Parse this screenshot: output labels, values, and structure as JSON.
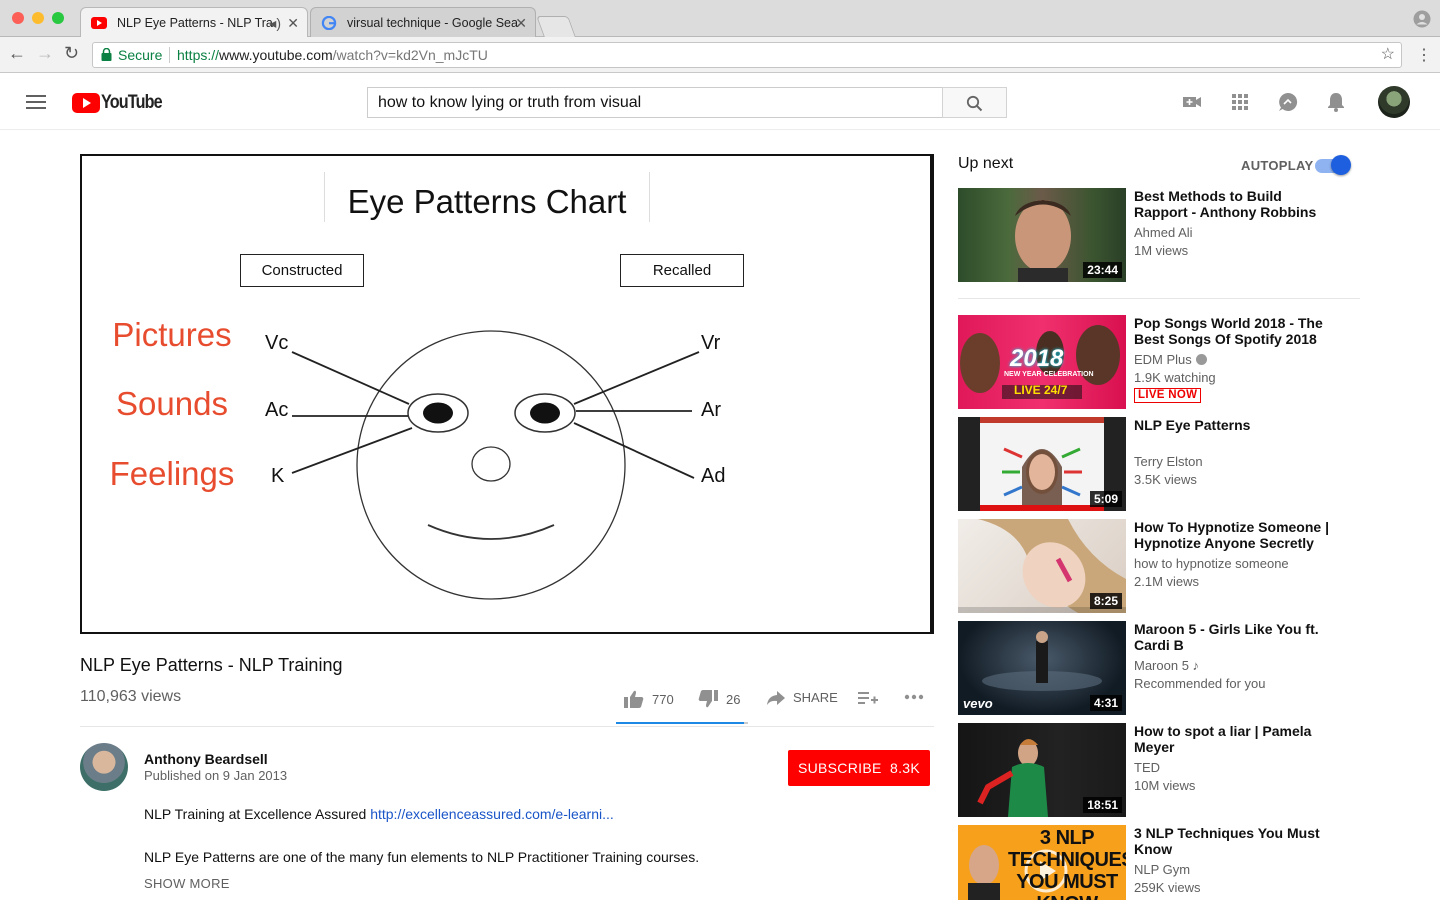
{
  "browser": {
    "tabs": [
      {
        "title": "NLP Eye Patterns - NLP Tra",
        "active": true
      },
      {
        "title": "virsual technique - Google Sea",
        "active": false
      }
    ],
    "secure_label": "Secure",
    "url_scheme": "https://",
    "url_host": "www.youtube.com",
    "url_path": "/watch?v=kd2Vn_mJcTU"
  },
  "header": {
    "logo_text": "YouTube",
    "search_value": "how to know lying or truth from visual"
  },
  "player": {
    "chart_title": "Eye Patterns Chart",
    "box_left": "Constructed",
    "box_right": "Recalled",
    "senses": [
      "Pictures",
      "Sounds",
      "Feelings"
    ],
    "codes_left": [
      "Vc",
      "Ac",
      "K"
    ],
    "codes_right": [
      "Vr",
      "Ar",
      "Ad"
    ]
  },
  "video": {
    "title": "NLP Eye Patterns - NLP Training",
    "views": "110,963 views",
    "likes": "770",
    "dislikes": "26",
    "share_label": "SHARE",
    "like_ratio": 0.967
  },
  "channel": {
    "name": "Anthony Beardsell",
    "published": "Published on 9 Jan 2013",
    "subscribe_label": "SUBSCRIBE",
    "subscriber_count": "8.3K"
  },
  "description": {
    "line1_text": "NLP Training at Excellence Assured ",
    "line1_link": "http://excellenceassured.com/e-learni...",
    "line2": "NLP Eye Patterns are one of the many fun elements to NLP Practitioner Training courses.",
    "show_more": "SHOW MORE"
  },
  "sidebar": {
    "up_next": "Up next",
    "autoplay_label": "AUTOPLAY",
    "autoplay_on": true,
    "items": [
      {
        "title": "Best Methods to Build Rapport - Anthony Robbins",
        "channel": "Ahmed Ali",
        "meta": "1M views",
        "duration": "23:44"
      },
      {
        "title": "Pop Songs World 2018 - The Best Songs Of Spotify 2018 ||...",
        "channel": "EDM Plus",
        "meta": "1.9K watching",
        "badge": "LIVE NOW"
      },
      {
        "title": "NLP Eye Patterns",
        "channel": "Terry Elston",
        "meta": "3.5K views",
        "duration": "5:09"
      },
      {
        "title": "How To Hypnotize Someone | Hypnotize Anyone Secretly",
        "channel": "how to hypnotize someone",
        "meta": "2.1M views",
        "duration": "8:25"
      },
      {
        "title": "Maroon 5 - Girls Like You ft. Cardi B",
        "channel": "Maroon 5 ♪",
        "meta": "Recommended for you",
        "duration": "4:31"
      },
      {
        "title": "How to spot a liar | Pamela Meyer",
        "channel": "TED",
        "meta": "10M views",
        "duration": "18:51"
      },
      {
        "title": "3 NLP Techniques You Must Know",
        "channel": "NLP Gym",
        "meta": "259K views"
      }
    ],
    "thumb_texts": {
      "pop_year": "2018",
      "pop_sub": "NEW YEAR CELEBRATION",
      "pop_live": "LIVE 24/7",
      "vevo": "vevo",
      "nlp_gym": "3 NLP TECHNIQUES YOU MUST KNOW"
    }
  },
  "colors": {
    "brand_red": "#ff0000",
    "link_blue": "#1a55c8",
    "sense_orange": "#e84c2e",
    "secure_green": "#0b8043"
  }
}
